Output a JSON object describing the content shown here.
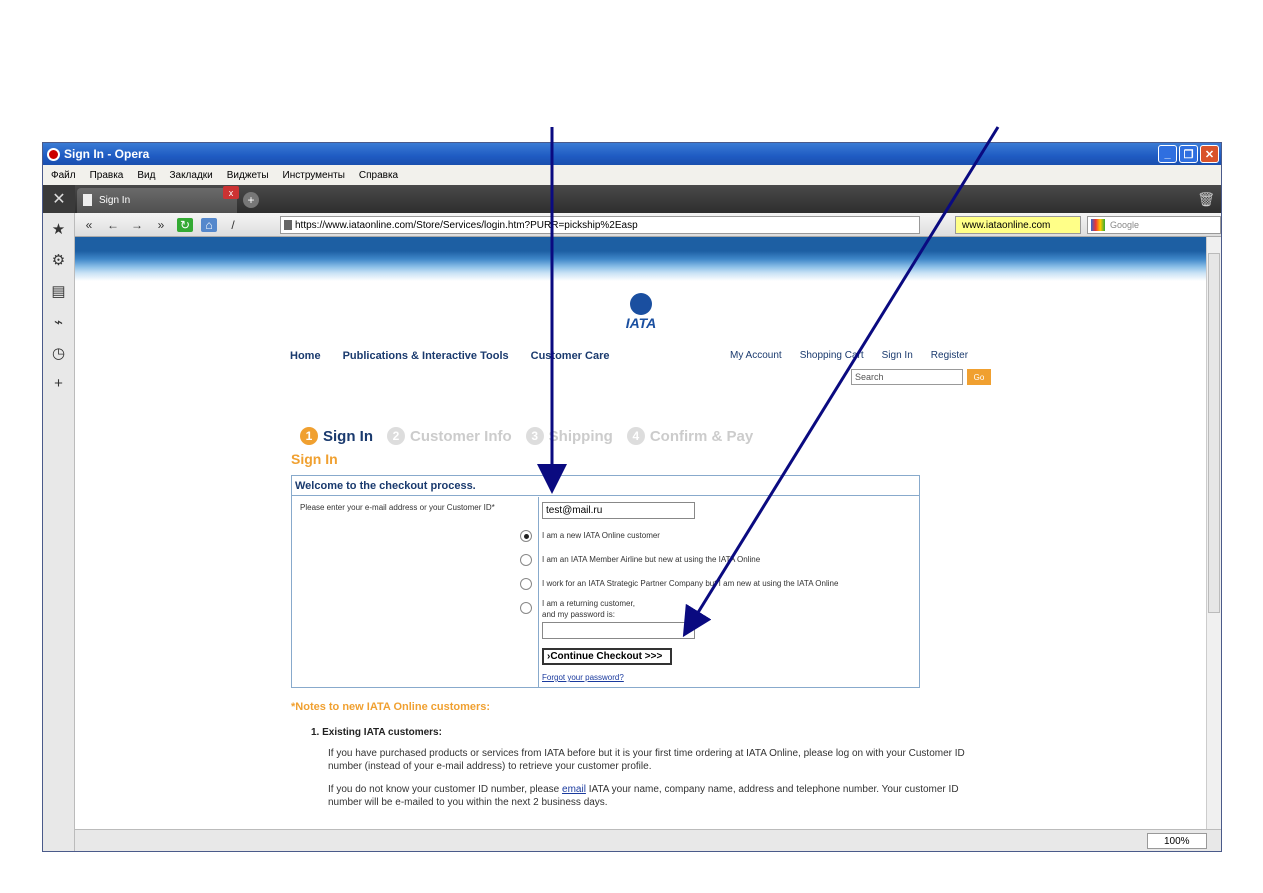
{
  "window": {
    "title": "Sign In - Opera"
  },
  "menu": [
    "Файл",
    "Правка",
    "Вид",
    "Закладки",
    "Виджеты",
    "Инструменты",
    "Справка"
  ],
  "tab": {
    "label": "Sign In"
  },
  "address": {
    "url": "https://www.iataonline.com/Store/Services/login.htm?PURR=pickship%2Easp",
    "site_badge": "www.iataonline.com",
    "search_placeholder": "Google"
  },
  "status": {
    "zoom": "100%"
  },
  "site": {
    "logo_text": "IATA",
    "nav": [
      "Home",
      "Publications & Interactive Tools",
      "Customer Care"
    ],
    "user_nav": [
      "My Account",
      "Shopping Cart",
      "Sign In",
      "Register"
    ],
    "search_placeholder": "Search",
    "go_label": "Go"
  },
  "steps": [
    {
      "num": "1",
      "label": "Sign In"
    },
    {
      "num": "2",
      "label": "Customer Info"
    },
    {
      "num": "3",
      "label": "Shipping"
    },
    {
      "num": "4",
      "label": "Confirm & Pay"
    }
  ],
  "form": {
    "heading": "Sign In",
    "box_title": "Welcome to the checkout process.",
    "email_label": "Please enter your e-mail address or your Customer ID*",
    "email_value": "test@mail.ru",
    "options": [
      "I am a new IATA Online customer",
      "I am an IATA Member Airline but new at using the IATA Online",
      "I work for an IATA Strategic Partner Company but I am new at using the IATA Online",
      "I am a returning customer,",
      "and my password is:"
    ],
    "continue_label": "›Continue Checkout >>>",
    "forgot_label": "Forgot your password?"
  },
  "notes": {
    "heading": "*Notes to new IATA Online customers:",
    "item1_title": "1.  Existing IATA customers:",
    "p1": "If you have purchased products or services from IATA before but it is your first time ordering at IATA Online, please log on with your Customer ID number (instead of your e-mail address) to retrieve your customer profile.",
    "p2_before": "If you do not know your customer ID number, please ",
    "p2_link": "email",
    "p2_after": " IATA your name, company name, address and telephone number. Your customer ID number will be e-mailed to you within the next 2 business days."
  }
}
